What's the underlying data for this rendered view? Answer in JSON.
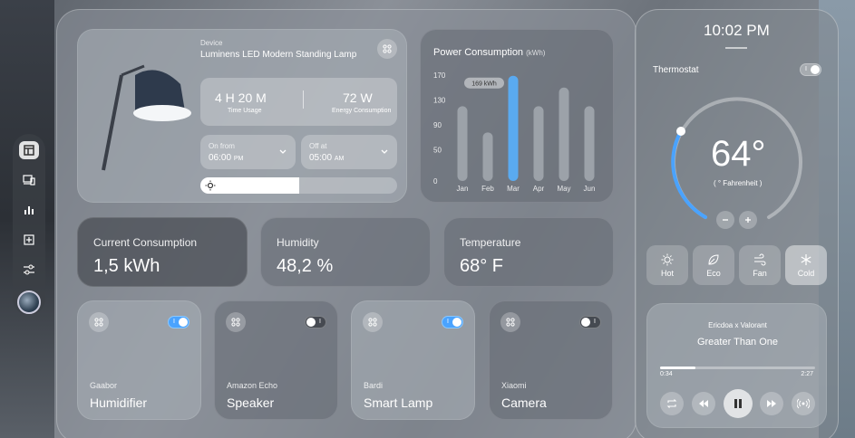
{
  "nav": {
    "items": [
      {
        "name": "dashboard",
        "icon": "dashboard-icon"
      },
      {
        "name": "devices",
        "icon": "devices-icon"
      },
      {
        "name": "stats",
        "icon": "bar-chart-icon"
      },
      {
        "name": "add",
        "icon": "plus-square-icon"
      },
      {
        "name": "settings",
        "icon": "sliders-icon"
      }
    ]
  },
  "lamp": {
    "device_label": "Device",
    "device_name": "Luminens LED Modern Standing Lamp",
    "time_usage_value": "4 H  20 M",
    "time_usage_label": "Time Usage",
    "energy_value": "72 W",
    "energy_label": "Energy Consumption",
    "on_from_label": "On from",
    "on_from_time": "06:00",
    "on_from_period": "PM",
    "off_at_label": "Off at",
    "off_at_time": "05:00",
    "off_at_period": "AM",
    "brightness": 0.5
  },
  "power": {
    "title": "Power Consumption",
    "unit": "(kWh)",
    "tooltip": "169 kWh"
  },
  "chart_data": {
    "type": "bar",
    "title": "Power Consumption (kWh)",
    "categories": [
      "Jan",
      "Feb",
      "Mar",
      "Apr",
      "May",
      "Jun"
    ],
    "values": [
      120,
      78,
      169,
      120,
      150,
      120
    ],
    "highlight_index": 2,
    "ylim": [
      0,
      170
    ],
    "yticks": [
      "170",
      "130",
      "90",
      "50",
      "0"
    ]
  },
  "stats": {
    "current": {
      "label": "Current Consumption",
      "value": "1,5 kWh"
    },
    "humidity": {
      "label": "Humidity",
      "value": "48,2 %"
    },
    "temperature": {
      "label": "Temperature",
      "value": "68° F"
    }
  },
  "devices": [
    {
      "brand": "Gaabor",
      "name": "Humidifier",
      "on": true
    },
    {
      "brand": "Amazon Echo",
      "name": "Speaker",
      "on": false
    },
    {
      "brand": "Bardi",
      "name": "Smart Lamp",
      "on": true
    },
    {
      "brand": "Xiaomi",
      "name": "Camera",
      "on": false
    }
  ],
  "right": {
    "time": "10:02 PM",
    "thermostat_label": "Thermostat",
    "temp_value": "64°",
    "temp_unit": "( ° Fahrenheit )",
    "modes": [
      {
        "label": "Hot",
        "icon": "sun-icon"
      },
      {
        "label": "Eco",
        "icon": "leaf-icon"
      },
      {
        "label": "Fan",
        "icon": "fan-icon"
      },
      {
        "label": "Cold",
        "icon": "snowflake-icon"
      }
    ],
    "active_mode": "Cold",
    "music": {
      "artist": "Ericdoa x Valorant",
      "track": "Greater Than One",
      "elapsed": "0:34",
      "total": "2:27",
      "progress": 0.23
    }
  },
  "colors": {
    "accent": "#4aa3ff",
    "bar": "#9ca2a9",
    "bar_highlight": "#5aaaf0"
  }
}
